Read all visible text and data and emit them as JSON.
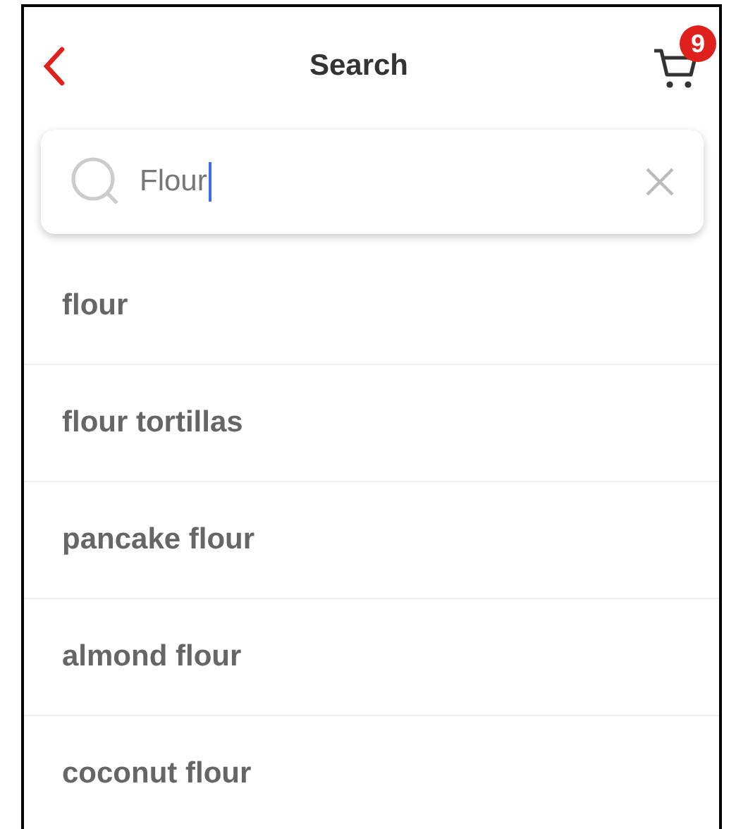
{
  "header": {
    "title": "Search",
    "cart_count": "9"
  },
  "search": {
    "value": "Flour"
  },
  "suggestions": [
    "flour",
    "flour tortillas",
    "pancake flour",
    "almond flour",
    "coconut flour"
  ]
}
